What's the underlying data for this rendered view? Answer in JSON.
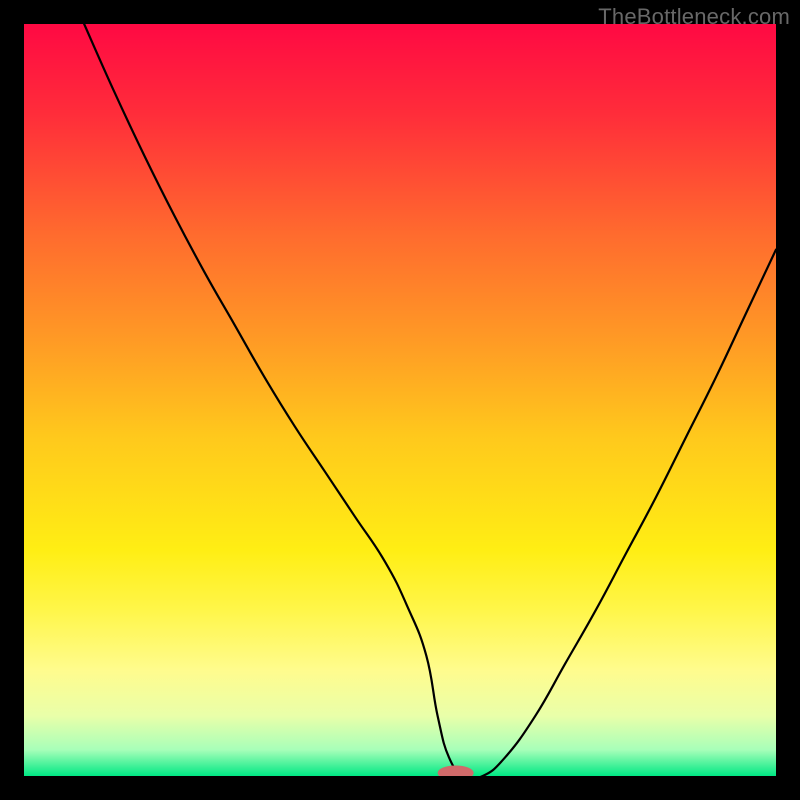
{
  "watermark": "TheBottleneck.com",
  "chart_data": {
    "type": "line",
    "title": "",
    "xlabel": "",
    "ylabel": "",
    "xlim": [
      0,
      100
    ],
    "ylim": [
      0,
      100
    ],
    "grid": false,
    "legend": false,
    "background_gradient": {
      "stops": [
        {
          "offset": 0.0,
          "color": "#ff0943"
        },
        {
          "offset": 0.12,
          "color": "#ff2d3a"
        },
        {
          "offset": 0.28,
          "color": "#ff6b2e"
        },
        {
          "offset": 0.42,
          "color": "#ff9a25"
        },
        {
          "offset": 0.55,
          "color": "#ffc91c"
        },
        {
          "offset": 0.7,
          "color": "#ffee14"
        },
        {
          "offset": 0.78,
          "color": "#fff64a"
        },
        {
          "offset": 0.86,
          "color": "#fffc8e"
        },
        {
          "offset": 0.92,
          "color": "#e9ffa9"
        },
        {
          "offset": 0.965,
          "color": "#a8ffb9"
        },
        {
          "offset": 1.0,
          "color": "#00e884"
        }
      ]
    },
    "series": [
      {
        "name": "bottleneck-curve",
        "type": "line",
        "color": "#000000",
        "width": 2.2,
        "x": [
          8,
          12,
          16,
          20,
          24,
          28,
          32,
          36,
          40,
          44,
          48,
          51,
          53.5,
          55,
          56.5,
          58.5,
          61,
          64,
          68,
          72,
          76,
          80,
          84,
          88,
          92,
          96,
          100
        ],
        "values": [
          100,
          91,
          82.5,
          74.5,
          67,
          60,
          53,
          46.5,
          40.5,
          34.5,
          28.5,
          22.5,
          16,
          8,
          2.5,
          0,
          0,
          2.5,
          8,
          15,
          22,
          29.5,
          37,
          45,
          53,
          61.5,
          70
        ]
      }
    ],
    "marker": {
      "name": "optimum-marker",
      "x": 57.4,
      "y": 0.4,
      "rx": 2.4,
      "ry": 1.0,
      "color": "#d06a6a"
    }
  }
}
